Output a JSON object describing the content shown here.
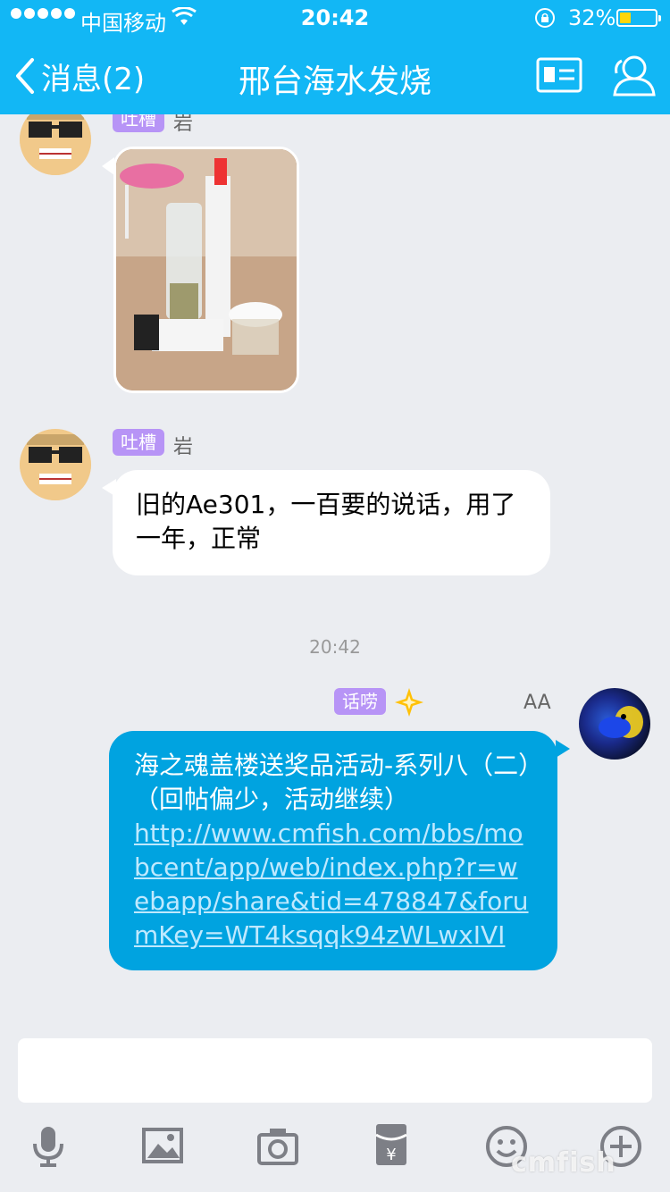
{
  "status_bar": {
    "carrier": "中国移动",
    "time": "20:42",
    "battery_pct": "32%",
    "battery_level": 0.32
  },
  "nav": {
    "back_label": "消息(2)",
    "title": "邢台海水发烧"
  },
  "messages": [
    {
      "type": "image",
      "tag": "吐槽",
      "sender": "岩"
    },
    {
      "type": "text",
      "tag": "吐槽",
      "sender": "岩",
      "text": "旧的Ae301，一百要的说话，用了一年，正常"
    },
    {
      "type": "time",
      "text": "20:42"
    },
    {
      "type": "text",
      "tag": "话唠",
      "sender": "AA",
      "text": "海之魂盖楼送奖品活动-系列八（二）（回帖偏少，活动继续）",
      "link": "http://www.cmfish.com/bbs/mobcent/app/web/index.php?r=webapp/share&tid=478847&forumKey=WT4ksqqk94zWLwxIVI"
    }
  ],
  "input": {
    "placeholder": ""
  },
  "toolbar": [
    "mic-icon",
    "image-icon",
    "camera-icon",
    "red-packet-icon",
    "emoji-icon",
    "plus-icon"
  ],
  "watermark": "cmfish",
  "colors": {
    "header": "#12b7f5",
    "outgoing_bubble": "#00a3e0",
    "tag_purple": "#b794f6",
    "background": "#ebedf1"
  }
}
